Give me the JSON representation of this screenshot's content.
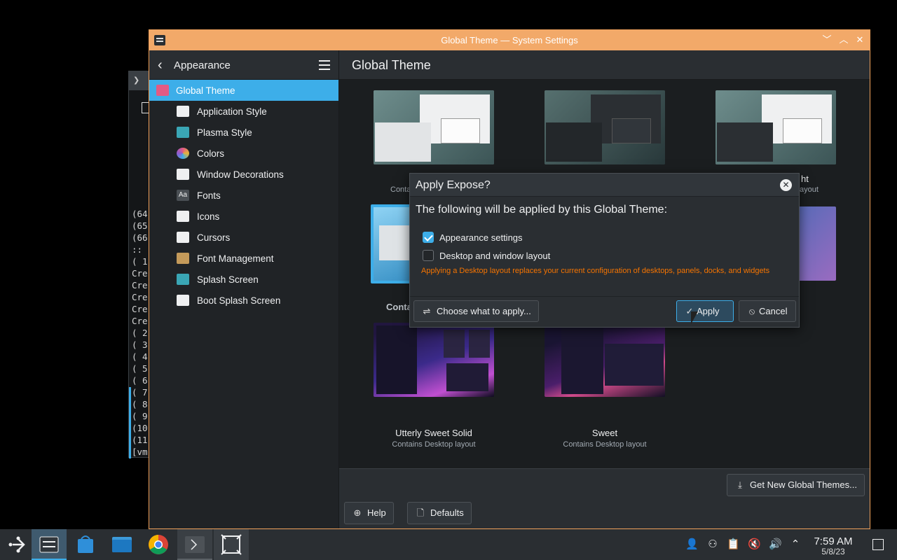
{
  "terminal": {
    "lines": "(64\n(65\n(66\n:: \n( 1\nCre\nCre\nCre\nCre\nCre\n( 2\n( 3\n( 4\n( 5\n( 6\n( 7\n( 8\n( 9\n(10\n(11\n[vm"
  },
  "window": {
    "title": "Global Theme — System Settings"
  },
  "sidebar": {
    "header": "Appearance",
    "items": [
      {
        "label": "Global Theme",
        "icon": "global-theme-icon",
        "color": "#e35b84"
      },
      {
        "label": "Application Style",
        "icon": "application-style-icon",
        "color": "#eff0f1"
      },
      {
        "label": "Plasma Style",
        "icon": "plasma-style-icon",
        "color": "#3aa6b5"
      },
      {
        "label": "Colors",
        "icon": "colors-icon",
        "color": "#e4b43a"
      },
      {
        "label": "Window Decorations",
        "icon": "window-decorations-icon",
        "color": "#eff0f1"
      },
      {
        "label": "Fonts",
        "icon": "fonts-icon",
        "color": "#4a4f54"
      },
      {
        "label": "Icons",
        "icon": "icons-icon",
        "color": "#eff0f1"
      },
      {
        "label": "Cursors",
        "icon": "cursors-icon",
        "color": "#eff0f1"
      },
      {
        "label": "Font Management",
        "icon": "font-management-icon",
        "color": "#c49a5a"
      },
      {
        "label": "Splash Screen",
        "icon": "splash-screen-icon",
        "color": "#3aa6b5"
      },
      {
        "label": "Boot Splash Screen",
        "icon": "boot-splash-screen-icon",
        "color": "#eff0f1"
      }
    ]
  },
  "content": {
    "title": "Global Theme",
    "themes": [
      {
        "name": "",
        "sub": "Conta"
      },
      {
        "name": "",
        "sub": ""
      },
      {
        "name": "ht",
        "sub": "ayout"
      },
      {
        "name": "Conta",
        "sub": ""
      },
      {
        "name": "",
        "sub": ""
      },
      {
        "name": "",
        "sub": ""
      },
      {
        "name": "Utterly Sweet Solid",
        "sub": "Contains Desktop layout"
      },
      {
        "name": "Sweet",
        "sub": "Contains Desktop layout"
      }
    ],
    "get_new": "Get New Global Themes...",
    "help": "Help",
    "defaults": "Defaults"
  },
  "dialog": {
    "title": "Apply Expose?",
    "heading": "The following will be applied by this Global Theme:",
    "options": [
      {
        "label": "Appearance settings",
        "checked": true
      },
      {
        "label": "Desktop and window layout",
        "checked": false
      }
    ],
    "warning": "Applying a Desktop layout replaces your current configuration of desktops, panels, docks, and widgets",
    "choose": "Choose what to apply...",
    "apply": "Apply",
    "cancel": "Cancel"
  },
  "taskbar": {
    "time": "7:59 AM",
    "date": "5/8/23"
  },
  "colors": {
    "accent": "#3daee9",
    "titlebar": "#f2a969",
    "warning": "#f67400"
  }
}
